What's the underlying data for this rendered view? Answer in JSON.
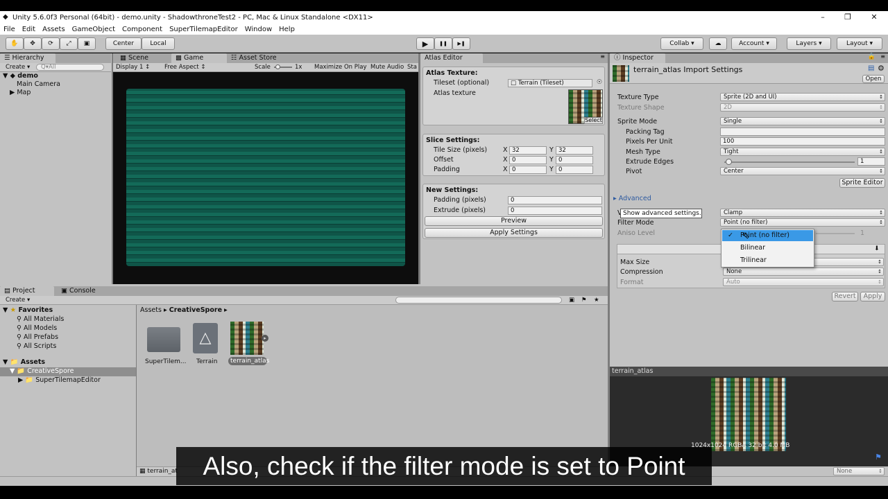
{
  "window": {
    "title": "Unity 5.6.0f3 Personal (64bit) - demo.unity - ShadowthroneTest2 - PC, Mac & Linux Standalone <DX11>",
    "minimize": "–",
    "maximize": "❐",
    "close": "✕"
  },
  "menu": [
    "File",
    "Edit",
    "Assets",
    "GameObject",
    "Component",
    "SuperTilemapEditor",
    "Window",
    "Help"
  ],
  "toolbar": {
    "center": "Center",
    "local": "Local",
    "play_icon": "▶",
    "pause_icon": "❚❚",
    "step_icon": "▶❚",
    "collab": "Collab ▾",
    "account": "Account",
    "layers": "Layers",
    "layout": "Layout"
  },
  "hierarchy": {
    "tab": "Hierarchy",
    "create": "Create ▾",
    "search_placeholder": "Q▾All",
    "scene": "demo",
    "items": [
      "Main Camera",
      "Map"
    ]
  },
  "game": {
    "tabs": [
      "Scene",
      "Game",
      "Asset Store"
    ],
    "display": "Display 1",
    "aspect": "Free Aspect",
    "scale_label": "Scale",
    "scale_value": "1x",
    "maximize": "Maximize On Play",
    "mute": "Mute Audio",
    "stats": "Sta"
  },
  "atlas_editor": {
    "tab": "Atlas Editor",
    "atlas_texture_heading": "Atlas Texture:",
    "tileset_label": "Tileset (optional)",
    "tileset_value": "Terrain (Tileset)",
    "atlas_texture_label": "Atlas texture",
    "select": "Select",
    "slice_heading": "Slice Settings:",
    "tile_size_label": "Tile Size (pixels)",
    "offset_label": "Offset",
    "padding_label": "Padding",
    "x": "X",
    "y": "Y",
    "tile_x": "32",
    "tile_y": "32",
    "offset_x": "0",
    "offset_y": "0",
    "padding_x": "0",
    "padding_y": "0",
    "new_heading": "New Settings:",
    "padding_pixels_label": "Padding (pixels)",
    "padding_pixels_value": "0",
    "extrude_label": "Extrude (pixels)",
    "extrude_value": "0",
    "preview": "Preview",
    "apply": "Apply Settings"
  },
  "inspector": {
    "tab": "Inspector",
    "title": "terrain_atlas Import Settings",
    "open": "Open",
    "texture_type_label": "Texture Type",
    "texture_type": "Sprite (2D and UI)",
    "texture_shape_label": "Texture Shape",
    "texture_shape": "2D",
    "sprite_mode_label": "Sprite Mode",
    "sprite_mode": "Single",
    "packing_tag_label": "Packing Tag",
    "packing_tag": "",
    "ppu_label": "Pixels Per Unit",
    "ppu": "100",
    "mesh_type_label": "Mesh Type",
    "mesh_type": "Tight",
    "extrude_label": "Extrude Edges",
    "extrude": "1",
    "extrude_fraction": 0.03,
    "pivot_label": "Pivot",
    "pivot": "Center",
    "sprite_editor": "Sprite Editor",
    "advanced": "Advanced",
    "tooltip": "Show advanced settings.",
    "wrap_prefix": "V",
    "wrap_mode": "Clamp",
    "filter_label": "Filter Mode",
    "filter_mode": "Point (no filter)",
    "aniso_label": "Aniso Level",
    "aniso": "1",
    "max_size_label": "Max Size",
    "compression_label": "Compression",
    "compression": "None",
    "format_label": "Format",
    "format": "Auto",
    "revert": "Revert",
    "apply": "Apply",
    "filter_options": [
      {
        "label": "Point (no filter)",
        "selected": true
      },
      {
        "label": "Bilinear",
        "selected": false
      },
      {
        "label": "Trilinear",
        "selected": false
      }
    ],
    "check": "✓"
  },
  "preview": {
    "title": "terrain_atlas",
    "info": "1024x1024 RGBA 32 bit 4.0 MB",
    "footer_dd": "None"
  },
  "project": {
    "tabs": [
      "Project",
      "Console"
    ],
    "create": "Create ▾",
    "favorites_label": "Favorites",
    "favorites": [
      "All Materials",
      "All Models",
      "All Prefabs",
      "All Scripts"
    ],
    "assets_label": "Assets",
    "folders": [
      "CreativeSpore",
      "SuperTilemapEditor"
    ],
    "breadcrumb": [
      "Assets",
      "CreativeSpore"
    ],
    "breadcrumb_sep": "▸",
    "items": [
      "SuperTilem...",
      "Terrain",
      "terrain_atlas"
    ],
    "footer_file": "terrain_at"
  },
  "caption": "Also, check if the filter mode is set to Point"
}
